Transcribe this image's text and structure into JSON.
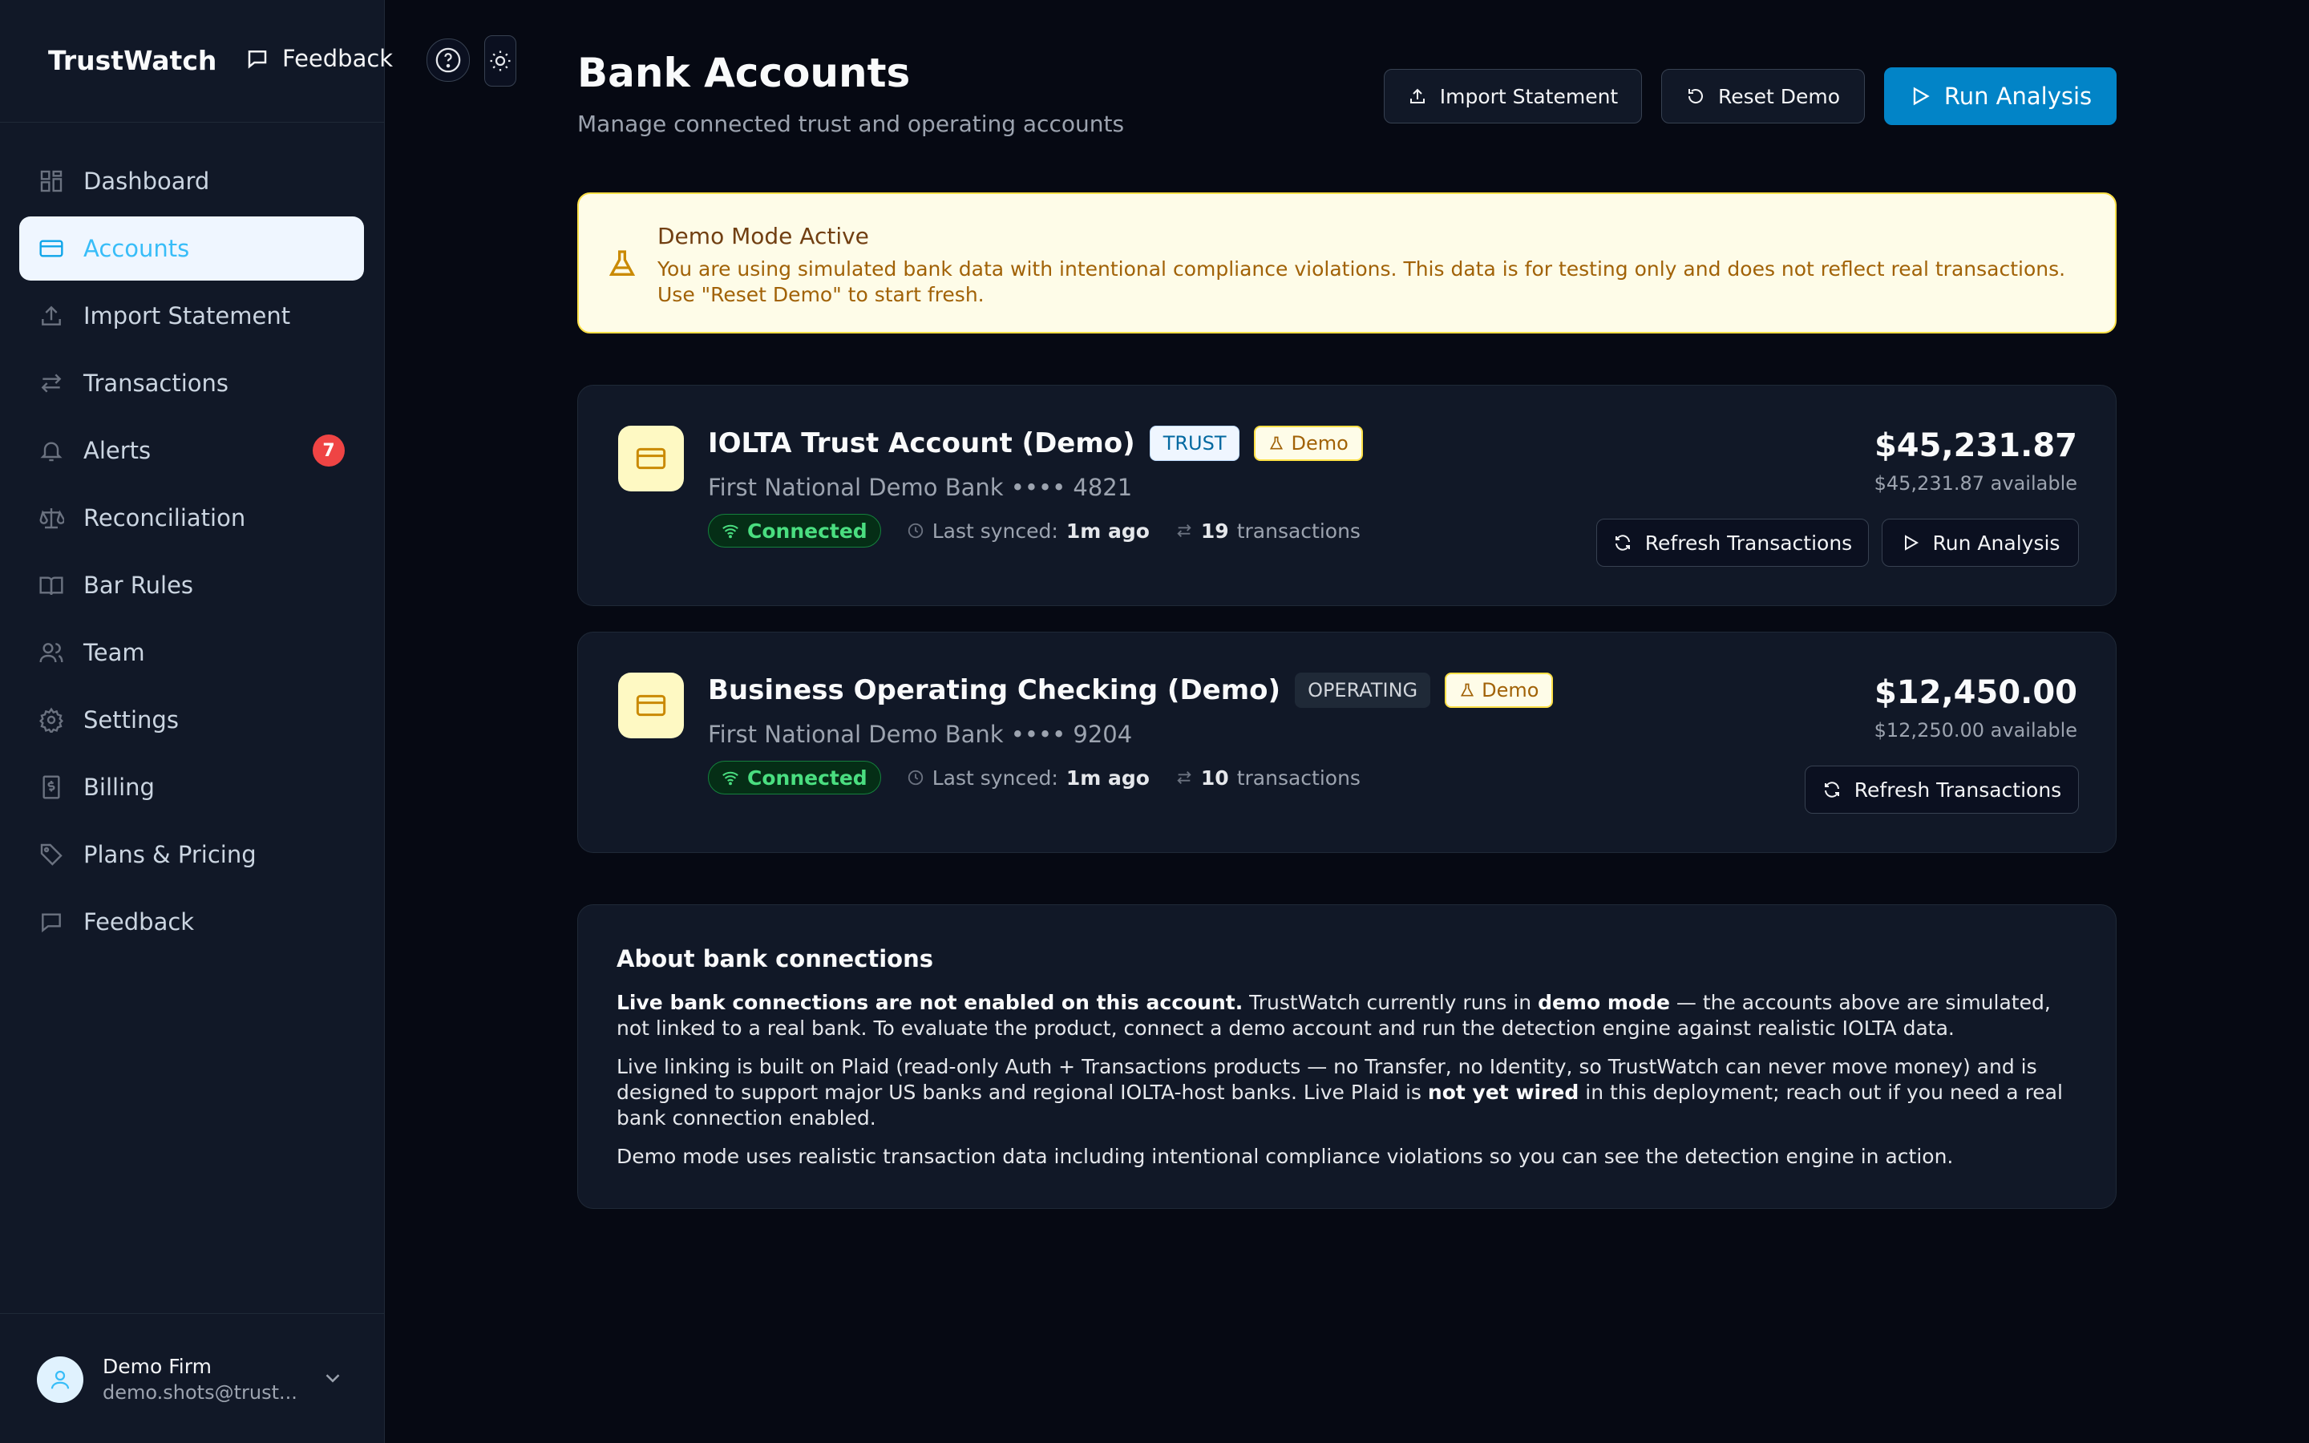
{
  "app": {
    "brand": "TrustWatch",
    "topbar_feedback": "Feedback"
  },
  "sidebar": {
    "items": [
      {
        "label": "Dashboard",
        "icon": "dashboard-icon"
      },
      {
        "label": "Accounts",
        "icon": "credit-card-icon",
        "active": true
      },
      {
        "label": "Import Statement",
        "icon": "upload-icon"
      },
      {
        "label": "Transactions",
        "icon": "arrows-icon"
      },
      {
        "label": "Alerts",
        "icon": "bell-icon",
        "badge": "7"
      },
      {
        "label": "Reconciliation",
        "icon": "scale-icon"
      },
      {
        "label": "Bar Rules",
        "icon": "book-icon"
      },
      {
        "label": "Team",
        "icon": "users-icon"
      },
      {
        "label": "Settings",
        "icon": "gear-icon"
      },
      {
        "label": "Billing",
        "icon": "receipt-icon"
      },
      {
        "label": "Plans & Pricing",
        "icon": "tag-icon"
      },
      {
        "label": "Feedback",
        "icon": "message-icon"
      }
    ],
    "user": {
      "name": "Demo Firm",
      "email": "demo.shots@trust..."
    }
  },
  "header": {
    "title": "Bank Accounts",
    "subtitle": "Manage connected trust and operating accounts",
    "import_label": "Import Statement",
    "reset_label": "Reset Demo",
    "run_label": "Run Analysis"
  },
  "banner": {
    "title": "Demo Mode Active",
    "text": "You are using simulated bank data with intentional compliance violations. This data is for testing only and does not reflect real transactions. Use \"Reset Demo\" to start fresh."
  },
  "accounts": [
    {
      "name": "IOLTA Trust Account (Demo)",
      "type": "TRUST",
      "demo_tag": "Demo",
      "bank": "First National Demo Bank •••• 4821",
      "status": "Connected",
      "synced_label": "Last synced:",
      "synced_value": "1m ago",
      "tx_count": "19",
      "tx_label": "transactions",
      "balance": "$45,231.87",
      "available": "$45,231.87 available",
      "refresh_label": "Refresh Transactions",
      "run_label": "Run Analysis"
    },
    {
      "name": "Business Operating Checking (Demo)",
      "type": "OPERATING",
      "demo_tag": "Demo",
      "bank": "First National Demo Bank •••• 9204",
      "status": "Connected",
      "synced_label": "Last synced:",
      "synced_value": "1m ago",
      "tx_count": "10",
      "tx_label": "transactions",
      "balance": "$12,450.00",
      "available": "$12,250.00 available",
      "refresh_label": "Refresh Transactions"
    }
  ],
  "about": {
    "title": "About bank connections",
    "p1_bold": "Live bank connections are not enabled on this account.",
    "p1_a": " TrustWatch currently runs in ",
    "p1_bold2": "demo mode",
    "p1_b": " — the accounts above are simulated, not linked to a real bank. To evaluate the product, connect a demo account and run the detection engine against realistic IOLTA data.",
    "p2_a": "Live linking is built on Plaid (read-only Auth + Transactions products — no Transfer, no Identity, so TrustWatch can never move money) and is designed to support major US banks and regional IOLTA-host banks. Live Plaid is ",
    "p2_bold": "not yet wired",
    "p2_b": " in this deployment; reach out if you need a real bank connection enabled.",
    "p3": "Demo mode uses realistic transaction data including intentional compliance violations so you can see the detection engine in action."
  },
  "colors": {
    "accent": "#0284c7",
    "active_nav": "#38bdf8",
    "alert_badge": "#ef4444",
    "connected": "#4ade80",
    "demo_yellow": "#fde047"
  }
}
